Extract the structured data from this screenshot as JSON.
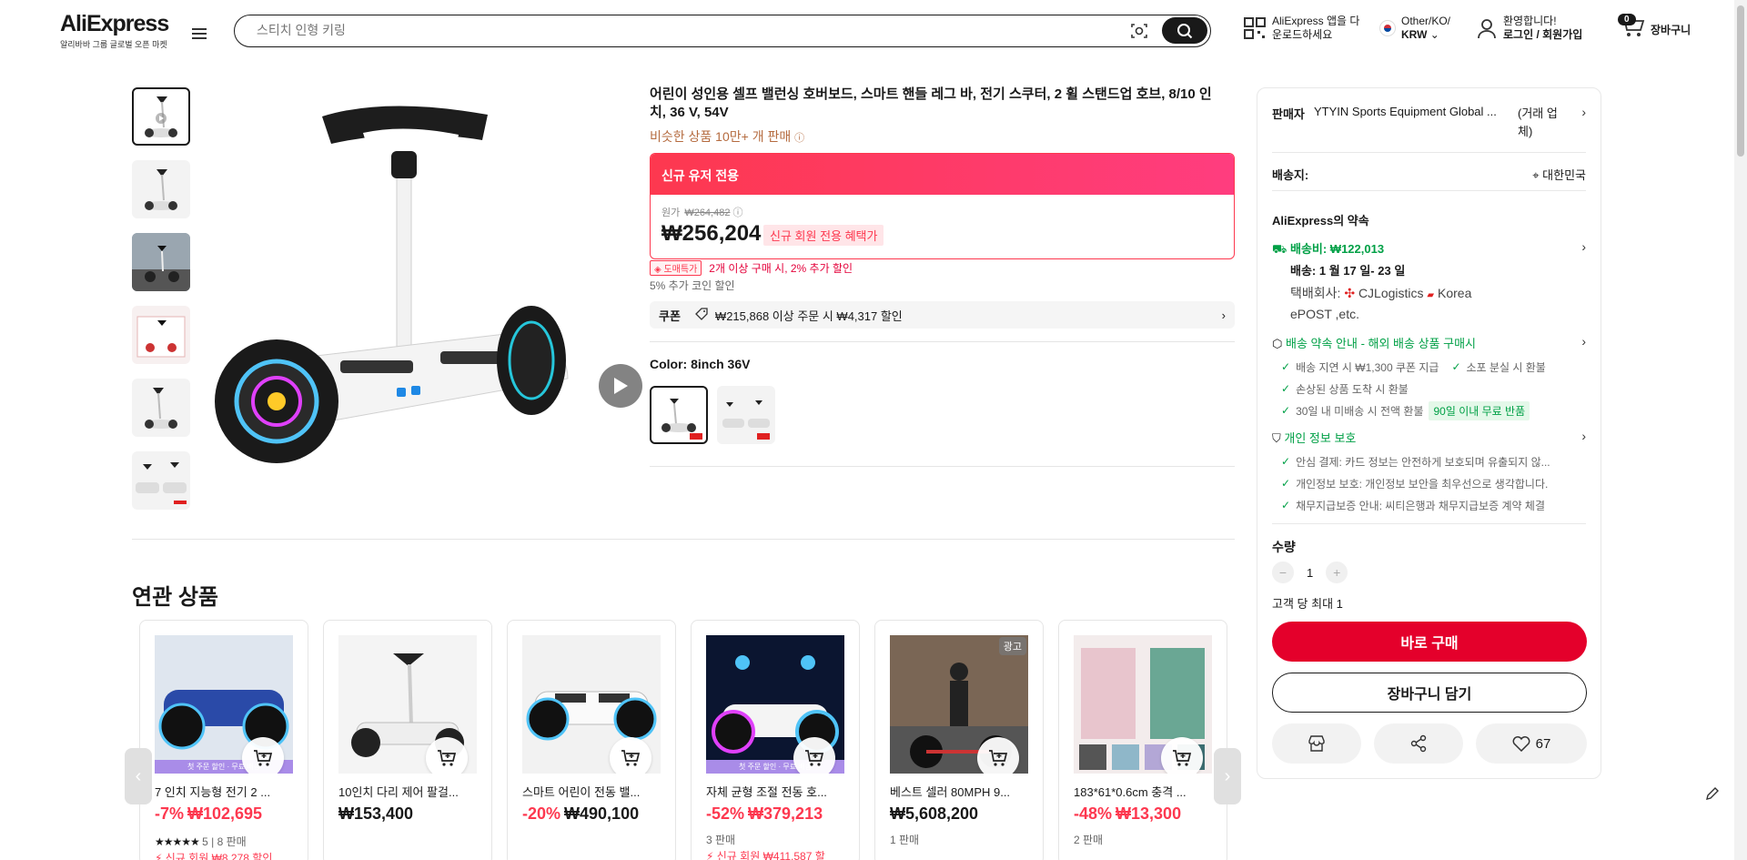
{
  "header": {
    "logo": "AliExpress",
    "logo_sub": "알리바바 그룹 글로벌 오픈 마켓",
    "search_placeholder": "스티치 인형 키링",
    "app_line1": "AliExpress 앱을 다",
    "app_line2": "운로드하세요",
    "locale_line1": "Other/KO/",
    "locale_line2": "KRW",
    "account_line1": "환영합니다!",
    "account_line2": "로그인 / 회원가입",
    "cart_count": "0",
    "cart_label": "장바구니"
  },
  "product": {
    "title": "어린이 성인용 셀프 밸런싱 호버보드, 스마트 핸들 레그 바, 전기 스쿠터, 2 휠 스탠드업 호브, 8/10 인치, 36 V, 54V",
    "sold": "비슷한 상품 10만+ 개 판매",
    "deal_header": "신규 유저 전용",
    "original_label": "원가",
    "original_price": "₩264,482",
    "price": "₩256,204",
    "new_user_tag": "신규 회원 전용 혜택가",
    "bulk_tag": "도매특가",
    "bulk_text": "2개 이상 구매 시, 2% 추가 할인",
    "coin_text": "5% 추가 코인 할인",
    "coupon_label": "쿠폰",
    "coupon_text": "₩215,868 이상 주문 시 ₩4,317 할인",
    "color_label": "Color: 8inch 36V"
  },
  "panel": {
    "seller_label": "판매자",
    "seller_name": "YTYIN Sports Equipment Global ...",
    "seller_type_1": "(거래 업",
    "seller_type_2": "체)",
    "ship_to_label": "배송지:",
    "ship_to_value": "대한민국",
    "promise_title": "AliExpress의 약속",
    "shipping_fee": "배송비: ₩122,013",
    "delivery": "배송: 1 월 17 일- 23 일",
    "carrier_label": "택배회사:",
    "carrier_1": "CJLogistics",
    "carrier_2": "Korea",
    "carrier_3": "ePOST ,etc.",
    "guarantee_title": "배송 약속 안내 - 해외 배송 상품 구매시",
    "g1": "배송 지연 시 ₩1,300 쿠폰 지급",
    "g2": "소포 분실 시 환불",
    "g3": "손상된 상품 도착 시 환불",
    "g4": "30일 내 미배송 시 전액 환불",
    "g4_tag": "90일 이내 무료 반품",
    "privacy_title": "개인 정보 보호",
    "p1": "안심 결제: 카드 정보는 안전하게 보호되며 유출되지 않...",
    "p2": "개인정보 보호: 개인정보 보안을 최우선으로 생각합니다.",
    "p3": "채무지급보증 안내: 씨티은행과 채무지급보증 계약 체결",
    "qty_label": "수량",
    "qty_value": "1",
    "qty_limit": "고객 당 최대 1",
    "buy_now": "바로 구매",
    "add_cart": "장바구니 담기",
    "likes": "67"
  },
  "related": {
    "title": "연관 상품",
    "promo_strip": "첫 주문 할인 · 무료 배송",
    "ad_label": "광고",
    "items": [
      {
        "name": "7 인치 지능형 전기 2 ...",
        "discount": "-7%",
        "price": "₩102,695",
        "rating": "5",
        "sold": "8 판매",
        "promo": "신규 회원 ₩8,278 할인"
      },
      {
        "name": "10인치 다리 제어 팔걸...",
        "discount": "",
        "price": "₩153,400",
        "rating": "",
        "sold": "",
        "promo": ""
      },
      {
        "name": "스마트 어린이 전동 밸...",
        "discount": "-20%",
        "price": "₩490,100",
        "rating": "",
        "sold": "",
        "promo": ""
      },
      {
        "name": "자체 균형 조절 전동 호...",
        "discount": "-52%",
        "price": "₩379,213",
        "rating": "",
        "sold": "3 판매",
        "promo": "신규 회원 ₩411,587 할"
      },
      {
        "name": "베스트 셀러 80MPH 9...",
        "discount": "",
        "price": "₩5,608,200",
        "rating": "",
        "sold": "1 판매",
        "promo": ""
      },
      {
        "name": "183*61*0.6cm 충격 ...",
        "discount": "-48%",
        "price": "₩13,300",
        "rating": "",
        "sold": "2 판매",
        "promo": ""
      }
    ]
  },
  "colors": {
    "accent": "#fd384f",
    "buy": "#e4002b",
    "green": "#00a046"
  }
}
